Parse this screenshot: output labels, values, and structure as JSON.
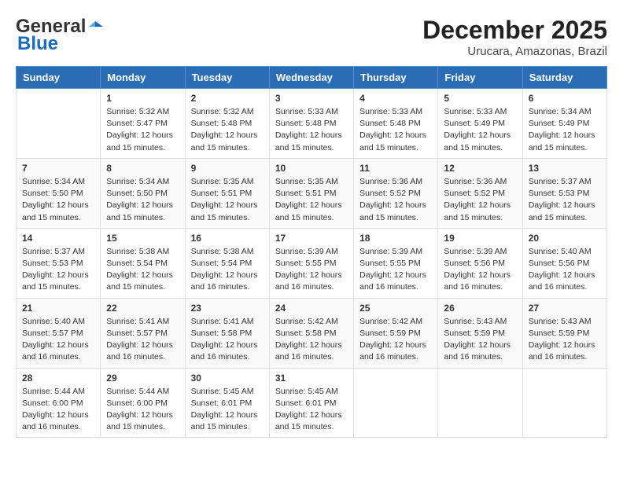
{
  "header": {
    "logo": {
      "general": "General",
      "blue": "Blue"
    },
    "title": "December 2025",
    "location": "Urucara, Amazonas, Brazil"
  },
  "weekdays": [
    "Sunday",
    "Monday",
    "Tuesday",
    "Wednesday",
    "Thursday",
    "Friday",
    "Saturday"
  ],
  "weeks": [
    [
      {
        "day": "",
        "info": ""
      },
      {
        "day": "1",
        "info": "Sunrise: 5:32 AM\nSunset: 5:47 PM\nDaylight: 12 hours\nand 15 minutes."
      },
      {
        "day": "2",
        "info": "Sunrise: 5:32 AM\nSunset: 5:48 PM\nDaylight: 12 hours\nand 15 minutes."
      },
      {
        "day": "3",
        "info": "Sunrise: 5:33 AM\nSunset: 5:48 PM\nDaylight: 12 hours\nand 15 minutes."
      },
      {
        "day": "4",
        "info": "Sunrise: 5:33 AM\nSunset: 5:48 PM\nDaylight: 12 hours\nand 15 minutes."
      },
      {
        "day": "5",
        "info": "Sunrise: 5:33 AM\nSunset: 5:49 PM\nDaylight: 12 hours\nand 15 minutes."
      },
      {
        "day": "6",
        "info": "Sunrise: 5:34 AM\nSunset: 5:49 PM\nDaylight: 12 hours\nand 15 minutes."
      }
    ],
    [
      {
        "day": "7",
        "info": "Sunrise: 5:34 AM\nSunset: 5:50 PM\nDaylight: 12 hours\nand 15 minutes."
      },
      {
        "day": "8",
        "info": "Sunrise: 5:34 AM\nSunset: 5:50 PM\nDaylight: 12 hours\nand 15 minutes."
      },
      {
        "day": "9",
        "info": "Sunrise: 5:35 AM\nSunset: 5:51 PM\nDaylight: 12 hours\nand 15 minutes."
      },
      {
        "day": "10",
        "info": "Sunrise: 5:35 AM\nSunset: 5:51 PM\nDaylight: 12 hours\nand 15 minutes."
      },
      {
        "day": "11",
        "info": "Sunrise: 5:36 AM\nSunset: 5:52 PM\nDaylight: 12 hours\nand 15 minutes."
      },
      {
        "day": "12",
        "info": "Sunrise: 5:36 AM\nSunset: 5:52 PM\nDaylight: 12 hours\nand 15 minutes."
      },
      {
        "day": "13",
        "info": "Sunrise: 5:37 AM\nSunset: 5:53 PM\nDaylight: 12 hours\nand 15 minutes."
      }
    ],
    [
      {
        "day": "14",
        "info": "Sunrise: 5:37 AM\nSunset: 5:53 PM\nDaylight: 12 hours\nand 15 minutes."
      },
      {
        "day": "15",
        "info": "Sunrise: 5:38 AM\nSunset: 5:54 PM\nDaylight: 12 hours\nand 15 minutes."
      },
      {
        "day": "16",
        "info": "Sunrise: 5:38 AM\nSunset: 5:54 PM\nDaylight: 12 hours\nand 16 minutes."
      },
      {
        "day": "17",
        "info": "Sunrise: 5:39 AM\nSunset: 5:55 PM\nDaylight: 12 hours\nand 16 minutes."
      },
      {
        "day": "18",
        "info": "Sunrise: 5:39 AM\nSunset: 5:55 PM\nDaylight: 12 hours\nand 16 minutes."
      },
      {
        "day": "19",
        "info": "Sunrise: 5:39 AM\nSunset: 5:56 PM\nDaylight: 12 hours\nand 16 minutes."
      },
      {
        "day": "20",
        "info": "Sunrise: 5:40 AM\nSunset: 5:56 PM\nDaylight: 12 hours\nand 16 minutes."
      }
    ],
    [
      {
        "day": "21",
        "info": "Sunrise: 5:40 AM\nSunset: 5:57 PM\nDaylight: 12 hours\nand 16 minutes."
      },
      {
        "day": "22",
        "info": "Sunrise: 5:41 AM\nSunset: 5:57 PM\nDaylight: 12 hours\nand 16 minutes."
      },
      {
        "day": "23",
        "info": "Sunrise: 5:41 AM\nSunset: 5:58 PM\nDaylight: 12 hours\nand 16 minutes."
      },
      {
        "day": "24",
        "info": "Sunrise: 5:42 AM\nSunset: 5:58 PM\nDaylight: 12 hours\nand 16 minutes."
      },
      {
        "day": "25",
        "info": "Sunrise: 5:42 AM\nSunset: 5:59 PM\nDaylight: 12 hours\nand 16 minutes."
      },
      {
        "day": "26",
        "info": "Sunrise: 5:43 AM\nSunset: 5:59 PM\nDaylight: 12 hours\nand 16 minutes."
      },
      {
        "day": "27",
        "info": "Sunrise: 5:43 AM\nSunset: 5:59 PM\nDaylight: 12 hours\nand 16 minutes."
      }
    ],
    [
      {
        "day": "28",
        "info": "Sunrise: 5:44 AM\nSunset: 6:00 PM\nDaylight: 12 hours\nand 16 minutes."
      },
      {
        "day": "29",
        "info": "Sunrise: 5:44 AM\nSunset: 6:00 PM\nDaylight: 12 hours\nand 15 minutes."
      },
      {
        "day": "30",
        "info": "Sunrise: 5:45 AM\nSunset: 6:01 PM\nDaylight: 12 hours\nand 15 minutes."
      },
      {
        "day": "31",
        "info": "Sunrise: 5:45 AM\nSunset: 6:01 PM\nDaylight: 12 hours\nand 15 minutes."
      },
      {
        "day": "",
        "info": ""
      },
      {
        "day": "",
        "info": ""
      },
      {
        "day": "",
        "info": ""
      }
    ]
  ]
}
